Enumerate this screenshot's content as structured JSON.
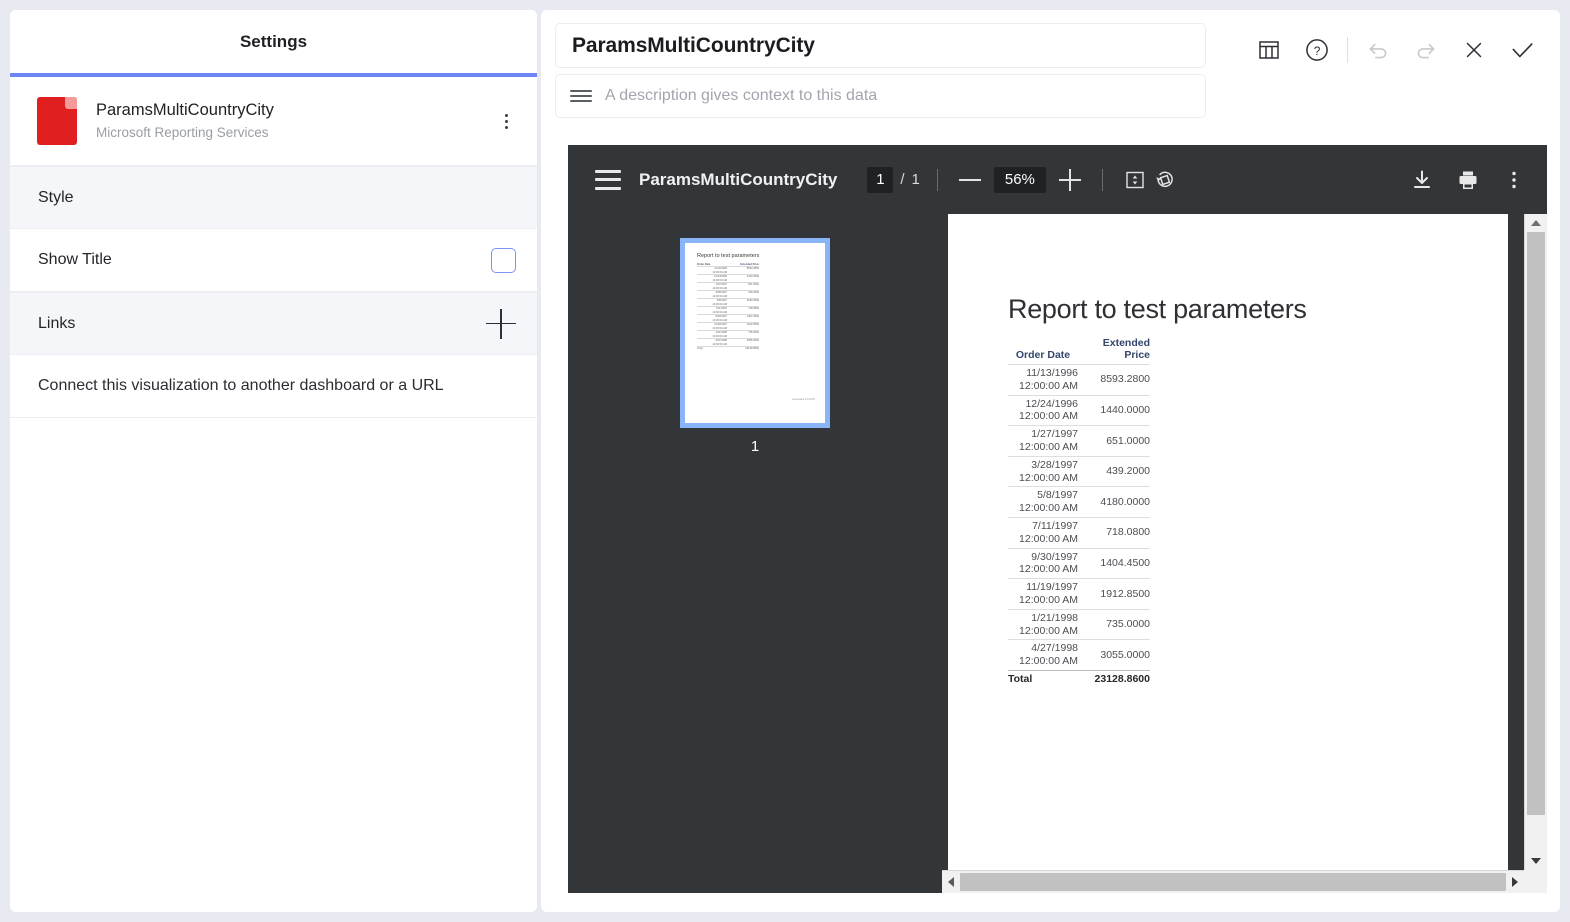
{
  "settings": {
    "header_title": "Settings",
    "visualization": {
      "name": "ParamsMultiCountryCity",
      "source": "Microsoft Reporting Services",
      "icon": "pdf-file-icon",
      "menu_icon": "kebab-menu-icon"
    },
    "sections": {
      "style": {
        "label": "Style",
        "options": [
          {
            "label": "Show Title",
            "checked": false
          }
        ]
      },
      "links": {
        "label": "Links",
        "add_icon": "plus-icon",
        "description": "Connect this visualization to another dashboard or a URL"
      }
    },
    "accent_color": "#6c86f5",
    "checkbox_border_color": "#7f93f0"
  },
  "editor": {
    "title_value": "ParamsMultiCountryCity",
    "description_placeholder": "A description gives context to this data",
    "description_icon": "text-lines-icon",
    "toolbar": [
      {
        "name": "table-view-icon",
        "label": "Table view",
        "disabled": false
      },
      {
        "name": "help-icon",
        "label": "Help",
        "disabled": false
      },
      {
        "name": "undo-icon",
        "label": "Undo",
        "disabled": true
      },
      {
        "name": "redo-icon",
        "label": "Redo",
        "disabled": true
      },
      {
        "name": "close-icon",
        "label": "Cancel",
        "disabled": false
      },
      {
        "name": "check-icon",
        "label": "Confirm",
        "disabled": false
      }
    ]
  },
  "pdf_viewer": {
    "menu_icon": "hamburger-menu-icon",
    "document_title": "ParamsMultiCountryCity",
    "page_current": "1",
    "page_separator": "/",
    "page_total": "1",
    "zoom_out_icon": "minus-icon",
    "zoom_level": "56%",
    "zoom_in_icon": "plus-icon",
    "fit_icon": "fit-to-page-icon",
    "rotate_icon": "rotate-counterclockwise-icon",
    "download_icon": "download-icon",
    "print_icon": "print-icon",
    "more_icon": "kebab-menu-icon",
    "thumbnail": {
      "page_label": "1",
      "selected": true
    },
    "background_color": "#333639",
    "selection_color": "#8ab4f8"
  },
  "report": {
    "title": "Report to test parameters",
    "columns": [
      "Order Date",
      "Extended Price"
    ],
    "column_header_lines": [
      [
        "Order Date"
      ],
      [
        "Extended",
        "Price"
      ]
    ],
    "rows": [
      {
        "date": "11/13/1996",
        "time": "12:00:00 AM",
        "price": "8593.2800"
      },
      {
        "date": "12/24/1996",
        "time": "12:00:00 AM",
        "price": "1440.0000"
      },
      {
        "date": "1/27/1997",
        "time": "12:00:00 AM",
        "price": "651.0000"
      },
      {
        "date": "3/28/1997",
        "time": "12:00:00 AM",
        "price": "439.2000"
      },
      {
        "date": "5/8/1997",
        "time": "12:00:00 AM",
        "price": "4180.0000"
      },
      {
        "date": "7/11/1997",
        "time": "12:00:00 AM",
        "price": "718.0800"
      },
      {
        "date": "9/30/1997",
        "time": "12:00:00 AM",
        "price": "1404.4500"
      },
      {
        "date": "11/19/1997",
        "time": "12:00:00 AM",
        "price": "1912.8500"
      },
      {
        "date": "1/21/1998",
        "time": "12:00:00 AM",
        "price": "735.0000"
      },
      {
        "date": "4/27/1998",
        "time": "12:00:00 AM",
        "price": "3055.0000"
      }
    ],
    "total_label": "Total",
    "total_value": "23128.8600"
  }
}
